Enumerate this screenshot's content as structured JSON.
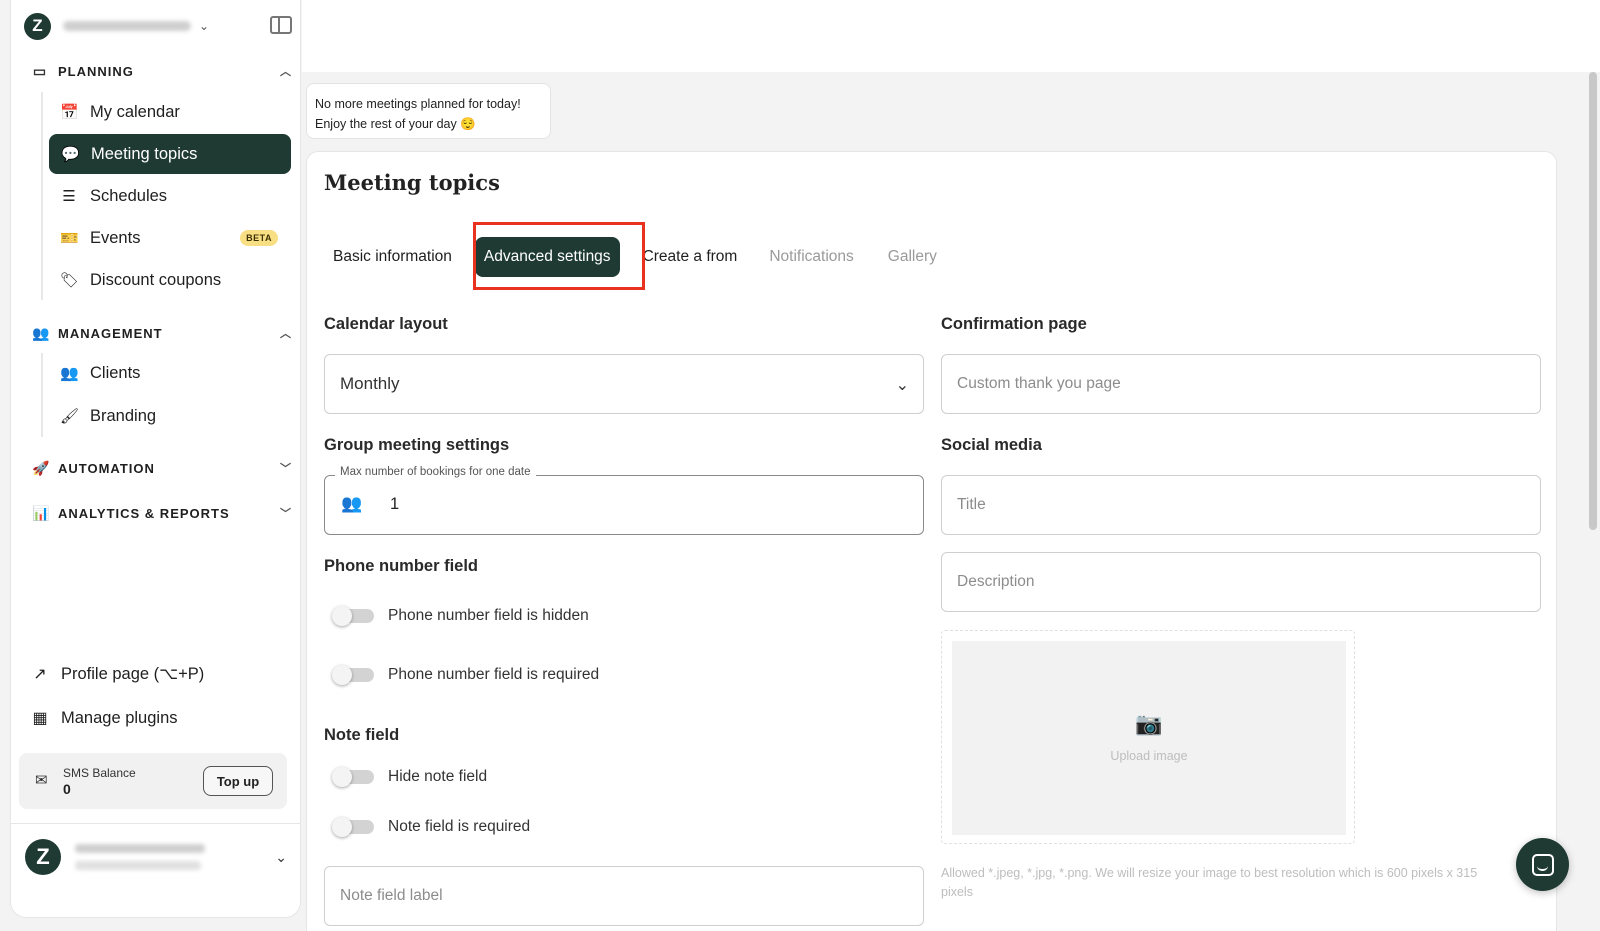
{
  "colors": {
    "brand": "#1e3a32",
    "highlight": "#e8321e",
    "beta_badge": "#f9df84"
  },
  "sidebar": {
    "sections": [
      {
        "title": "PLANNING",
        "icon": "calendar-icon",
        "expanded": true,
        "items": [
          {
            "label": "My calendar",
            "icon": "calendar-icon"
          },
          {
            "label": "Meeting topics",
            "icon": "chat-bubbles-icon",
            "active": true
          },
          {
            "label": "Schedules",
            "icon": "list-icon"
          },
          {
            "label": "Events",
            "icon": "ticket-icon",
            "badge": "BETA"
          },
          {
            "label": "Discount coupons",
            "icon": "coupon-icon"
          }
        ]
      },
      {
        "title": "MANAGEMENT",
        "icon": "users-icon",
        "expanded": true,
        "items": [
          {
            "label": "Clients",
            "icon": "users-icon"
          },
          {
            "label": "Branding",
            "icon": "brush-icon"
          }
        ]
      },
      {
        "title": "AUTOMATION",
        "icon": "rocket-icon",
        "expanded": false
      },
      {
        "title": "ANALYTICS & REPORTS",
        "icon": "chart-icon",
        "expanded": false
      }
    ],
    "profile_page_label": "Profile page (⌥+P)",
    "manage_plugins_label": "Manage plugins",
    "sms": {
      "label": "SMS Balance",
      "value": "0",
      "topup_label": "Top up"
    }
  },
  "notice": {
    "line1": "No more meetings planned for today!",
    "line2": "Enjoy the rest of your day 😌"
  },
  "main": {
    "title": "Meeting topics",
    "tabs": [
      {
        "label": "Basic information",
        "state": "normal"
      },
      {
        "label": "Advanced settings",
        "state": "active"
      },
      {
        "label": "Create a from",
        "state": "normal"
      },
      {
        "label": "Notifications",
        "state": "muted"
      },
      {
        "label": "Gallery",
        "state": "muted"
      }
    ],
    "calendar_layout": {
      "label": "Calendar layout",
      "value": "Monthly"
    },
    "group_meeting": {
      "label": "Group meeting settings",
      "field_label": "Max number of bookings for one date",
      "value": "1"
    },
    "phone_field": {
      "label": "Phone number field",
      "toggle_hidden": "Phone number field is hidden",
      "toggle_required": "Phone number field is required"
    },
    "note_field": {
      "label": "Note field",
      "toggle_hide": "Hide note field",
      "toggle_required": "Note field is required",
      "label_placeholder": "Note field label"
    },
    "confirmation": {
      "label": "Confirmation page",
      "placeholder": "Custom thank you page"
    },
    "social": {
      "label": "Social media",
      "title_placeholder": "Title",
      "description_placeholder": "Description"
    },
    "upload": {
      "label": "Upload image",
      "hint": "Allowed *.jpeg, *.jpg, *.png. We will resize your image to best resolution which is 600 pixels x 315 pixels"
    }
  }
}
